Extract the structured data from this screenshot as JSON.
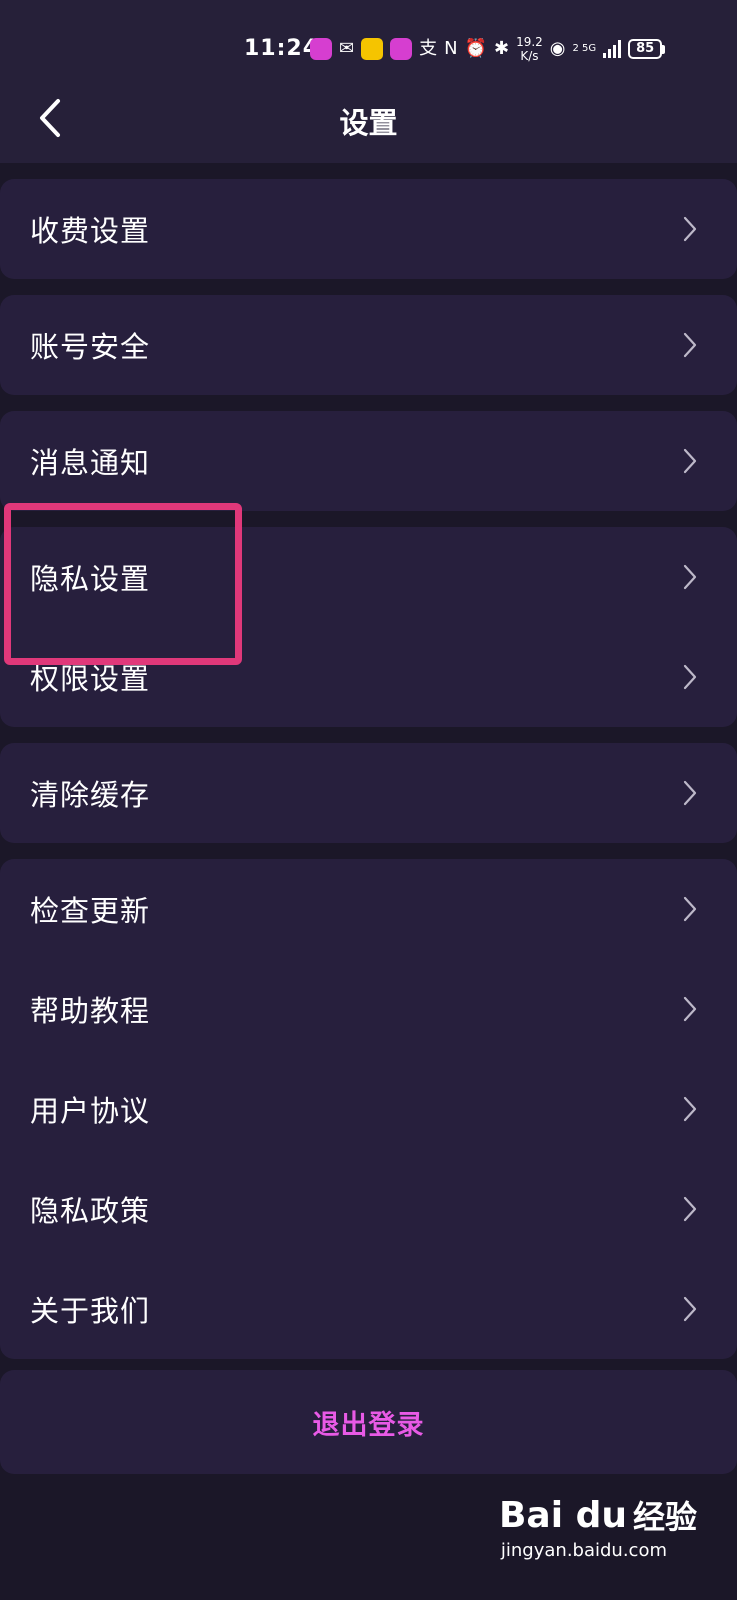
{
  "status_bar": {
    "time": "11:24",
    "net_speed_value": "19.2",
    "net_speed_unit": "K/s",
    "signal_label": "2 5G",
    "battery": "85"
  },
  "header": {
    "title": "设置"
  },
  "groups": [
    {
      "items": [
        {
          "label": "收费设置"
        }
      ]
    },
    {
      "items": [
        {
          "label": "账号安全"
        }
      ]
    },
    {
      "items": [
        {
          "label": "消息通知"
        }
      ]
    },
    {
      "items": [
        {
          "label": "隐私设置"
        },
        {
          "label": "权限设置"
        }
      ]
    },
    {
      "items": [
        {
          "label": "清除缓存"
        }
      ]
    },
    {
      "items": [
        {
          "label": "检查更新"
        },
        {
          "label": "帮助教程"
        },
        {
          "label": "用户协议"
        },
        {
          "label": "隐私政策"
        },
        {
          "label": "关于我们"
        }
      ]
    }
  ],
  "logout": {
    "label": "退出登录"
  },
  "watermark": {
    "logo": "Bai du",
    "text": "经验",
    "url": "jingyan.baidu.com"
  },
  "colors": {
    "background": "#1b1728",
    "card": "#271f3d",
    "accent": "#e85ae6",
    "highlight": "#e0387a"
  }
}
